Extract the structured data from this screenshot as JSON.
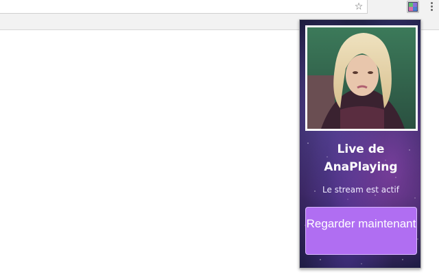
{
  "browser": {
    "star_icon": "star-icon",
    "extension_icon": "extension-icon",
    "menu_icon": "kebab-menu-icon"
  },
  "popup": {
    "avatar_alt": "AnaPlaying avatar",
    "title": "Live de AnaPlaying",
    "status": "Le stream est actif",
    "watch_button_label": "Regarder maintenant",
    "colors": {
      "button_bg": "#b06ef2",
      "button_border": "#d9b8ff",
      "background_dark": "#1b1c3c",
      "background_purple": "#3b2763"
    }
  }
}
